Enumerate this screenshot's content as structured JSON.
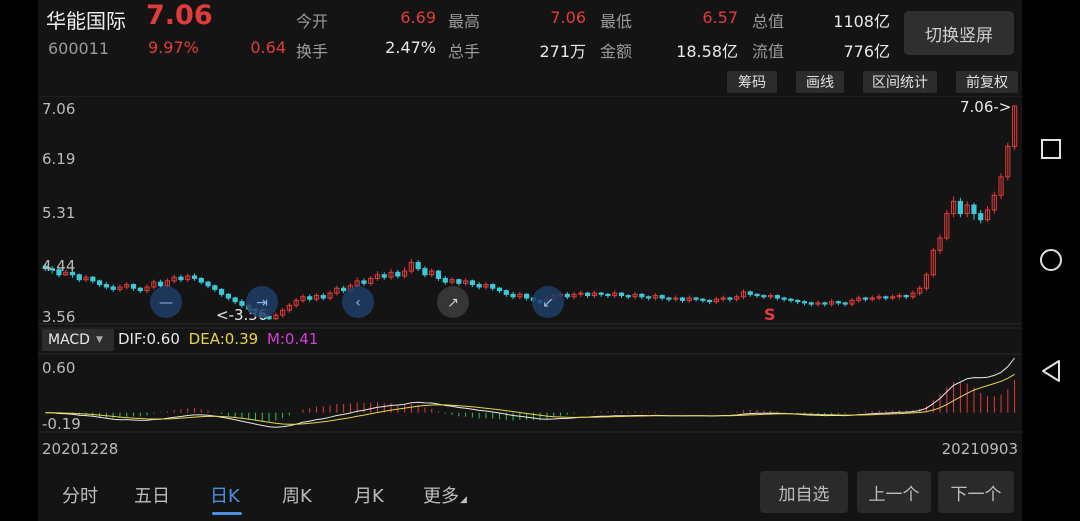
{
  "stock": {
    "name": "华能国际",
    "price": "7.06",
    "code": "600011",
    "change_pct": "9.97%",
    "change": "0.64"
  },
  "quote": {
    "open_label": "今开",
    "open": "6.69",
    "high_label": "最高",
    "high": "7.06",
    "low_label": "最低",
    "low": "6.57",
    "total_cap_label": "总值",
    "total_cap": "1108亿",
    "turnover_label": "换手",
    "turnover": "2.47%",
    "volume_label": "总手",
    "volume": "271万",
    "amount_label": "金额",
    "amount": "18.58亿",
    "float_cap_label": "流值",
    "float_cap": "776亿"
  },
  "switch_label": "切换竖屏",
  "toolbar": [
    "筹码",
    "画线",
    "区间统计",
    "前复权"
  ],
  "chart": {
    "y_ticks": [
      "7.06",
      "6.19",
      "5.31",
      "4.44",
      "3.56"
    ],
    "max_label": "7.06->",
    "min_label": "<-3.56",
    "signal": "S",
    "start_date": "20201228",
    "end_date": "20210903"
  },
  "macd": {
    "tab_label": "MACD",
    "dif_label": "DIF:0.60",
    "dea_label": "DEA:0.39",
    "m_label": "M:0.41",
    "y_top": "0.60",
    "y_bottom": "-0.19"
  },
  "periods": [
    "分时",
    "五日",
    "日K",
    "周K",
    "月K",
    "更多"
  ],
  "active_period": "日K",
  "buttons": [
    "加自选",
    "上一个",
    "下一个"
  ],
  "colors": {
    "up": "#e23b3b",
    "down": "#3cc8d8",
    "dif": "#e8e8e8",
    "dea": "#e8d44a",
    "m": "#d63ad6",
    "accent": "#4a8fe0"
  },
  "chart_data": {
    "type": "candlestick",
    "title": "",
    "x_range": [
      "20201228",
      "20210903"
    ],
    "ylim": [
      3.56,
      7.06
    ],
    "series": [
      {
        "values": [
          [
            4.44,
            4.4,
            4.48,
            4.36
          ],
          [
            4.4,
            4.38,
            4.44,
            4.32
          ],
          [
            4.38,
            4.3,
            4.4,
            4.26
          ],
          [
            4.3,
            4.34,
            4.38,
            4.28
          ],
          [
            4.34,
            4.3,
            4.36,
            4.25
          ],
          [
            4.3,
            4.22,
            4.32,
            4.18
          ],
          [
            4.22,
            4.26,
            4.3,
            4.18
          ],
          [
            4.26,
            4.2,
            4.28,
            4.16
          ],
          [
            4.2,
            4.14,
            4.22,
            4.1
          ],
          [
            4.14,
            4.1,
            4.18,
            4.06
          ],
          [
            4.1,
            4.06,
            4.14,
            4.02
          ],
          [
            4.06,
            4.1,
            4.14,
            4.02
          ],
          [
            4.1,
            4.14,
            4.18,
            4.06
          ],
          [
            4.14,
            4.08,
            4.16,
            4.04
          ],
          [
            4.08,
            4.04,
            4.1,
            4.0
          ],
          [
            4.04,
            4.1,
            4.14,
            4.0
          ],
          [
            4.1,
            4.18,
            4.22,
            4.06
          ],
          [
            4.18,
            4.12,
            4.22,
            4.08
          ],
          [
            4.12,
            4.2,
            4.24,
            4.08
          ],
          [
            4.2,
            4.26,
            4.3,
            4.16
          ],
          [
            4.26,
            4.22,
            4.3,
            4.18
          ],
          [
            4.22,
            4.28,
            4.32,
            4.18
          ],
          [
            4.28,
            4.24,
            4.32,
            4.2
          ],
          [
            4.24,
            4.18,
            4.26,
            4.14
          ],
          [
            4.18,
            4.12,
            4.2,
            4.08
          ],
          [
            4.12,
            4.06,
            4.14,
            4.02
          ],
          [
            4.06,
            3.98,
            4.08,
            3.94
          ],
          [
            3.98,
            3.92,
            4.0,
            3.88
          ],
          [
            3.92,
            3.86,
            3.94,
            3.82
          ],
          [
            3.86,
            3.8,
            3.9,
            3.76
          ],
          [
            3.8,
            3.74,
            3.84,
            3.7
          ],
          [
            3.74,
            3.68,
            3.76,
            3.64
          ],
          [
            3.68,
            3.62,
            3.7,
            3.58
          ],
          [
            3.62,
            3.58,
            3.66,
            3.56
          ],
          [
            3.58,
            3.64,
            3.68,
            3.56
          ],
          [
            3.64,
            3.72,
            3.76,
            3.6
          ],
          [
            3.72,
            3.8,
            3.84,
            3.68
          ],
          [
            3.8,
            3.88,
            3.92,
            3.76
          ],
          [
            3.88,
            3.94,
            3.98,
            3.84
          ],
          [
            3.94,
            3.9,
            3.98,
            3.86
          ],
          [
            3.9,
            3.96,
            4.0,
            3.86
          ],
          [
            3.96,
            3.92,
            4.0,
            3.88
          ],
          [
            3.92,
            4.0,
            4.04,
            3.88
          ],
          [
            4.0,
            4.08,
            4.12,
            3.96
          ],
          [
            4.08,
            4.04,
            4.12,
            4.0
          ],
          [
            4.04,
            4.12,
            4.16,
            4.0
          ],
          [
            4.12,
            4.2,
            4.26,
            4.08
          ],
          [
            4.2,
            4.16,
            4.24,
            4.12
          ],
          [
            4.16,
            4.24,
            4.28,
            4.12
          ],
          [
            4.24,
            4.3,
            4.36,
            4.2
          ],
          [
            4.3,
            4.26,
            4.34,
            4.22
          ],
          [
            4.26,
            4.34,
            4.4,
            4.22
          ],
          [
            4.34,
            4.28,
            4.38,
            4.24
          ],
          [
            4.28,
            4.36,
            4.42,
            4.24
          ],
          [
            4.36,
            4.5,
            4.56,
            4.32
          ],
          [
            4.5,
            4.4,
            4.54,
            4.36
          ],
          [
            4.4,
            4.3,
            4.44,
            4.26
          ],
          [
            4.3,
            4.36,
            4.4,
            4.26
          ],
          [
            4.36,
            4.24,
            4.38,
            4.2
          ],
          [
            4.24,
            4.18,
            4.28,
            4.14
          ],
          [
            4.18,
            4.22,
            4.26,
            4.14
          ],
          [
            4.22,
            4.16,
            4.24,
            4.12
          ],
          [
            4.16,
            4.2,
            4.24,
            4.12
          ],
          [
            4.2,
            4.14,
            4.22,
            4.1
          ],
          [
            4.14,
            4.1,
            4.18,
            4.06
          ],
          [
            4.1,
            4.14,
            4.18,
            4.06
          ],
          [
            4.14,
            4.08,
            4.16,
            4.04
          ],
          [
            4.08,
            4.04,
            4.1,
            4.0
          ],
          [
            4.04,
            3.98,
            4.06,
            3.94
          ],
          [
            3.98,
            3.94,
            4.02,
            3.9
          ],
          [
            3.94,
            3.98,
            4.02,
            3.9
          ],
          [
            3.98,
            3.92,
            4.0,
            3.88
          ],
          [
            3.92,
            3.88,
            3.94,
            3.84
          ],
          [
            3.88,
            3.84,
            3.9,
            3.8
          ],
          [
            3.84,
            3.9,
            3.94,
            3.8
          ],
          [
            3.9,
            3.96,
            4.0,
            3.86
          ],
          [
            3.96,
            3.98,
            4.02,
            3.92
          ],
          [
            3.98,
            3.94,
            4.02,
            3.9
          ],
          [
            3.94,
            3.98,
            4.02,
            3.9
          ],
          [
            3.98,
            4.0,
            4.04,
            3.94
          ],
          [
            4.0,
            3.96,
            4.02,
            3.92
          ],
          [
            3.96,
            4.0,
            4.04,
            3.92
          ],
          [
            4.0,
            3.98,
            4.02,
            3.94
          ],
          [
            3.98,
            3.96,
            4.0,
            3.92
          ],
          [
            3.96,
            4.0,
            4.04,
            3.92
          ],
          [
            4.0,
            3.96,
            4.02,
            3.92
          ],
          [
            3.96,
            3.94,
            3.98,
            3.9
          ],
          [
            3.94,
            3.98,
            4.02,
            3.9
          ],
          [
            3.98,
            3.94,
            4.0,
            3.9
          ],
          [
            3.94,
            3.92,
            3.96,
            3.88
          ],
          [
            3.92,
            3.96,
            4.0,
            3.88
          ],
          [
            3.96,
            3.92,
            3.98,
            3.88
          ],
          [
            3.92,
            3.9,
            3.94,
            3.86
          ],
          [
            3.9,
            3.92,
            3.96,
            3.86
          ],
          [
            3.92,
            3.88,
            3.94,
            3.84
          ],
          [
            3.88,
            3.92,
            3.96,
            3.84
          ],
          [
            3.92,
            3.9,
            3.94,
            3.86
          ],
          [
            3.9,
            3.88,
            3.92,
            3.84
          ],
          [
            3.88,
            3.86,
            3.9,
            3.82
          ],
          [
            3.86,
            3.9,
            3.94,
            3.82
          ],
          [
            3.9,
            3.92,
            3.96,
            3.86
          ],
          [
            3.92,
            3.9,
            3.94,
            3.86
          ],
          [
            3.9,
            3.94,
            3.98,
            3.86
          ],
          [
            3.94,
            4.02,
            4.06,
            3.9
          ],
          [
            4.02,
            3.98,
            4.04,
            3.94
          ],
          [
            3.98,
            3.96,
            4.0,
            3.92
          ],
          [
            3.96,
            3.94,
            3.98,
            3.9
          ],
          [
            3.94,
            3.96,
            4.0,
            3.9
          ],
          [
            3.96,
            3.92,
            3.98,
            3.88
          ],
          [
            3.92,
            3.9,
            3.94,
            3.86
          ],
          [
            3.9,
            3.88,
            3.92,
            3.84
          ],
          [
            3.88,
            3.86,
            3.9,
            3.82
          ],
          [
            3.86,
            3.84,
            3.88,
            3.8
          ],
          [
            3.84,
            3.82,
            3.86,
            3.78
          ],
          [
            3.82,
            3.84,
            3.88,
            3.78
          ],
          [
            3.84,
            3.82,
            3.86,
            3.78
          ],
          [
            3.82,
            3.86,
            3.9,
            3.78
          ],
          [
            3.86,
            3.84,
            3.88,
            3.8
          ],
          [
            3.84,
            3.82,
            3.86,
            3.78
          ],
          [
            3.82,
            3.88,
            3.92,
            3.78
          ],
          [
            3.88,
            3.92,
            3.96,
            3.84
          ],
          [
            3.92,
            3.9,
            3.94,
            3.86
          ],
          [
            3.9,
            3.92,
            3.96,
            3.86
          ],
          [
            3.92,
            3.94,
            3.98,
            3.88
          ],
          [
            3.94,
            3.92,
            3.96,
            3.88
          ],
          [
            3.92,
            3.94,
            3.98,
            3.88
          ],
          [
            3.94,
            3.96,
            4.0,
            3.9
          ],
          [
            3.96,
            3.94,
            3.98,
            3.9
          ],
          [
            3.94,
            4.0,
            4.04,
            3.9
          ],
          [
            4.0,
            4.08,
            4.12,
            3.96
          ],
          [
            4.08,
            4.3,
            4.34,
            4.04
          ],
          [
            4.3,
            4.7,
            4.74,
            4.26
          ],
          [
            4.7,
            4.9,
            4.96,
            4.64
          ],
          [
            4.9,
            5.3,
            5.36,
            4.86
          ],
          [
            5.3,
            5.5,
            5.58,
            5.24
          ],
          [
            5.5,
            5.3,
            5.56,
            5.24
          ],
          [
            5.3,
            5.44,
            5.5,
            5.24
          ],
          [
            5.44,
            5.3,
            5.48,
            5.2
          ],
          [
            5.3,
            5.2,
            5.36,
            5.14
          ],
          [
            5.2,
            5.36,
            5.42,
            5.16
          ],
          [
            5.36,
            5.6,
            5.66,
            5.3
          ],
          [
            5.6,
            5.9,
            5.96,
            5.54
          ],
          [
            5.9,
            6.4,
            6.46,
            5.84
          ],
          [
            6.4,
            7.06,
            7.06,
            6.34
          ]
        ]
      }
    ]
  }
}
